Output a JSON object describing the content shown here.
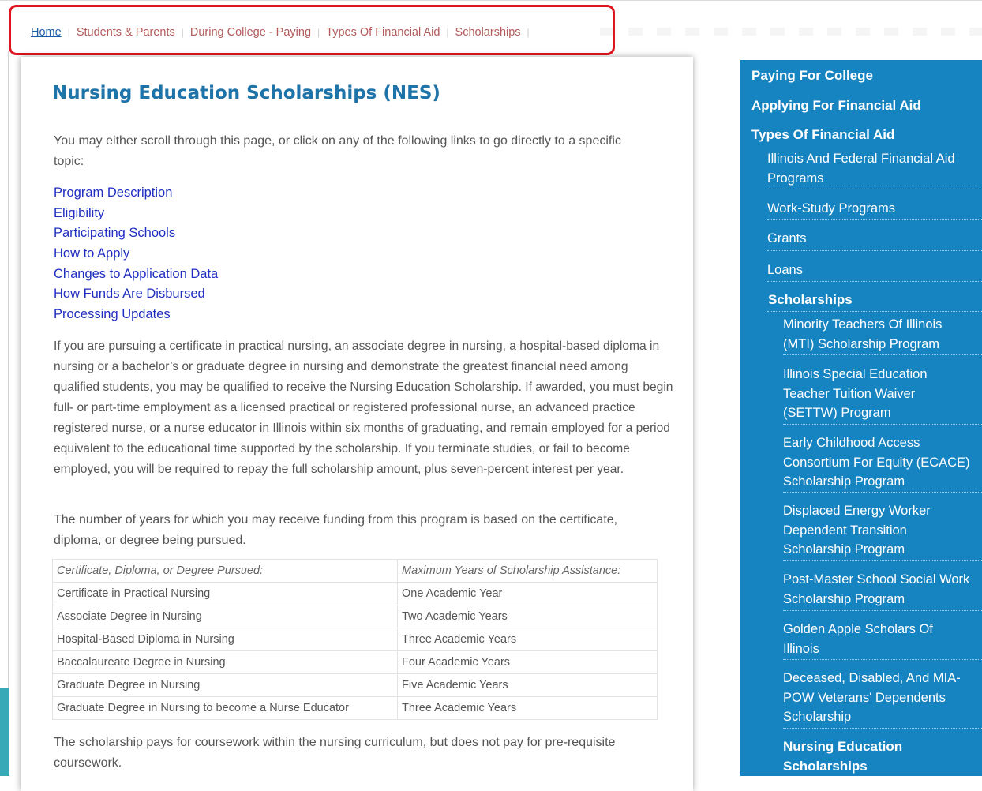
{
  "breadcrumb": [
    "Home",
    "Students & Parents",
    "During College - Paying",
    "Types Of Financial Aid",
    "Scholarships"
  ],
  "page": {
    "title": "Nursing Education Scholarships (NES)",
    "intro": "You may either scroll through this page, or click on any of the following links to go directly to a specific topic:",
    "links": [
      "Program Description",
      "Eligibility",
      "Participating Schools",
      "How to Apply",
      "Changes to Application Data",
      "How Funds Are Disbursed",
      "Processing Updates"
    ],
    "description": "If you are pursuing a certificate in practical nursing, an associate degree in nursing, a hospital-based diploma in nursing or a bachelor’s or graduate degree in nursing and demonstrate the greatest financial need among qualified students, you may be qualified to receive the Nursing Education Scholarship. If awarded, you must begin full- or part-time employment as a licensed practical or registered professional nurse, an advanced practice registered nurse, or a nurse educator in Illinois within six months of graduating, and remain employed for a period equivalent to the educational time supported by the scholarship. If you terminate studies, or fail to become employed, you will be required to repay the full scholarship amount, plus seven-percent interest per year.",
    "years_note": "The number of years for which you may receive funding from this program is based on the certificate, diploma, or degree being pursued.",
    "table": {
      "headers": [
        "Certificate, Diploma, or Degree Pursued:",
        "Maximum Years of Scholarship Assistance:"
      ],
      "rows": [
        [
          "Certificate in Practical Nursing",
          "One Academic Year"
        ],
        [
          "Associate Degree in Nursing",
          "Two Academic Years"
        ],
        [
          "Hospital-Based Diploma in Nursing",
          "Three Academic Years"
        ],
        [
          "Baccalaureate Degree in Nursing",
          "Four Academic Years"
        ],
        [
          "Graduate Degree in Nursing",
          "Five Academic Years"
        ],
        [
          "Graduate Degree in Nursing to become a Nurse Educator",
          "Three Academic Years"
        ]
      ]
    },
    "coursework_note": "The scholarship pays for coursework within the nursing curriculum, but does not pay for pre-requisite coursework."
  },
  "sidebar": {
    "paying": "Paying For College",
    "applying": "Applying For Financial Aid",
    "types": "Types Of Financial Aid",
    "sub": [
      "Illinois And Federal Financial Aid Programs",
      "Work-Study Programs",
      "Grants",
      "Loans"
    ],
    "scholarships": "Scholarships",
    "scholarship_items": [
      "Minority Teachers Of Illinois (MTI) Scholarship Program",
      "Illinois Special Education Teacher Tuition Waiver (SETTW) Program",
      "Early Childhood Access Consortium For Equity (ECACE) Scholarship Program",
      "Displaced Energy Worker Dependent Transition Scholarship Program",
      "Post-Master School Social Work Scholarship Program",
      "Golden Apple Scholars Of Illinois",
      "Deceased, Disabled, And MIA-POW Veterans' Dependents Scholarship"
    ],
    "active": "Nursing Education Scholarships"
  }
}
